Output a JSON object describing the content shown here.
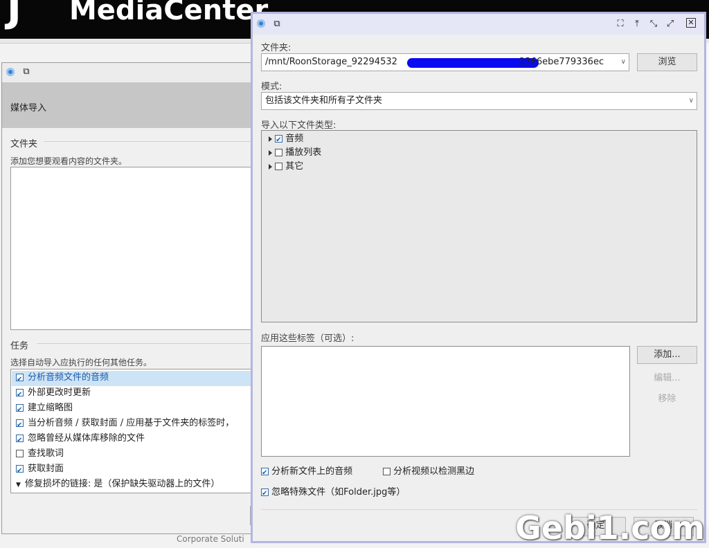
{
  "app": {
    "name": "MediaCenter",
    "logo_char": "J",
    "footer_text": "Corporate Soluti"
  },
  "back_window": {
    "title_icon": "restore-icon",
    "header": "媒体导入",
    "folder_section": "文件夹",
    "folder_hint": "添加您想要观看内容的文件夹。",
    "tasks_section": "任务",
    "tasks_hint": "选择自动导入应执行的任何其他任务。",
    "tasks": [
      {
        "label": "分析音频文件的音频",
        "checked": true,
        "selected": true
      },
      {
        "label": "外部更改时更新",
        "checked": true
      },
      {
        "label": "建立缩略图",
        "checked": true
      },
      {
        "label": "当分析音频 / 获取封面 / 应用基于文件夹的标签时，",
        "checked": true
      },
      {
        "label": "忽略曾经从媒体库移除的文件",
        "checked": true
      },
      {
        "label": "查找歌词",
        "checked": false
      },
      {
        "label": "获取封面",
        "checked": true
      }
    ],
    "repair_link": "修复损坏的链接: 是（保护缺失驱动器上的文件）"
  },
  "front_window": {
    "folder_label": "文件夹:",
    "folder_value": "/mnt/RoonStorage_92294532",
    "folder_value_tail": "2366ebe779336ec",
    "browse": "浏览",
    "mode_label": "模式:",
    "mode_value": "包括该文件夹和所有子文件夹",
    "types_label": "导入以下文件类型:",
    "types": [
      {
        "label": "音频",
        "checked": true
      },
      {
        "label": "播放列表",
        "checked": false
      },
      {
        "label": "其它",
        "checked": false
      }
    ],
    "tags_label": "应用这些标签（可选）:",
    "add": "添加...",
    "edit": "编辑...",
    "remove": "移除",
    "analyze_audio": "分析新文件上的音频",
    "analyze_audio_checked": true,
    "analyze_video": "分析视频以检测黑边",
    "analyze_video_checked": false,
    "ignore_special": "忽略特殊文件（如Folder.jpg等）",
    "ignore_special_checked": true,
    "ok": "确定",
    "cancel": "取消"
  },
  "watermark": "Gebi1.com"
}
